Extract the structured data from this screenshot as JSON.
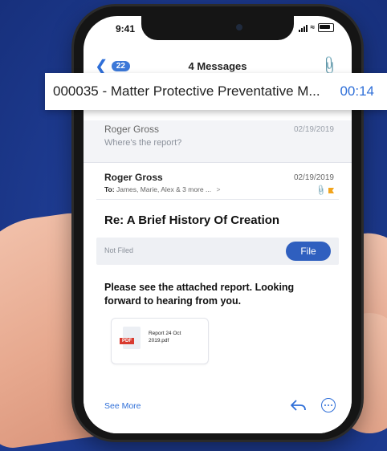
{
  "status_bar": {
    "time": "9:41"
  },
  "nav": {
    "back_badge": "22",
    "title": "4 Messages"
  },
  "banner": {
    "matter": "000035 - Matter Protective Preventative M...",
    "timer": "00:14"
  },
  "previous_message": {
    "sender": "Roger Gross",
    "date": "02/19/2019",
    "preview": "Where's the report?"
  },
  "open_message": {
    "sender": "Roger Gross",
    "date": "02/19/2019",
    "to_label": "To:",
    "to_recipients": "James, Marie, Alex & 3 more ...",
    "subject": "Re: A Brief History Of Creation",
    "filed_status": "Not Filed",
    "file_button": "File",
    "body": "Please see the attached report. Looking forward to hearing from you.",
    "attachment": {
      "type": "PDF",
      "name": "Report 24 Oct 2019.pdf"
    },
    "see_more": "See More"
  },
  "colors": {
    "background": "#1d3a8f",
    "accent": "#2f6fd8",
    "file_button": "#2f5fbf",
    "flag": "#f2a41c",
    "pdf": "#d93b30"
  }
}
